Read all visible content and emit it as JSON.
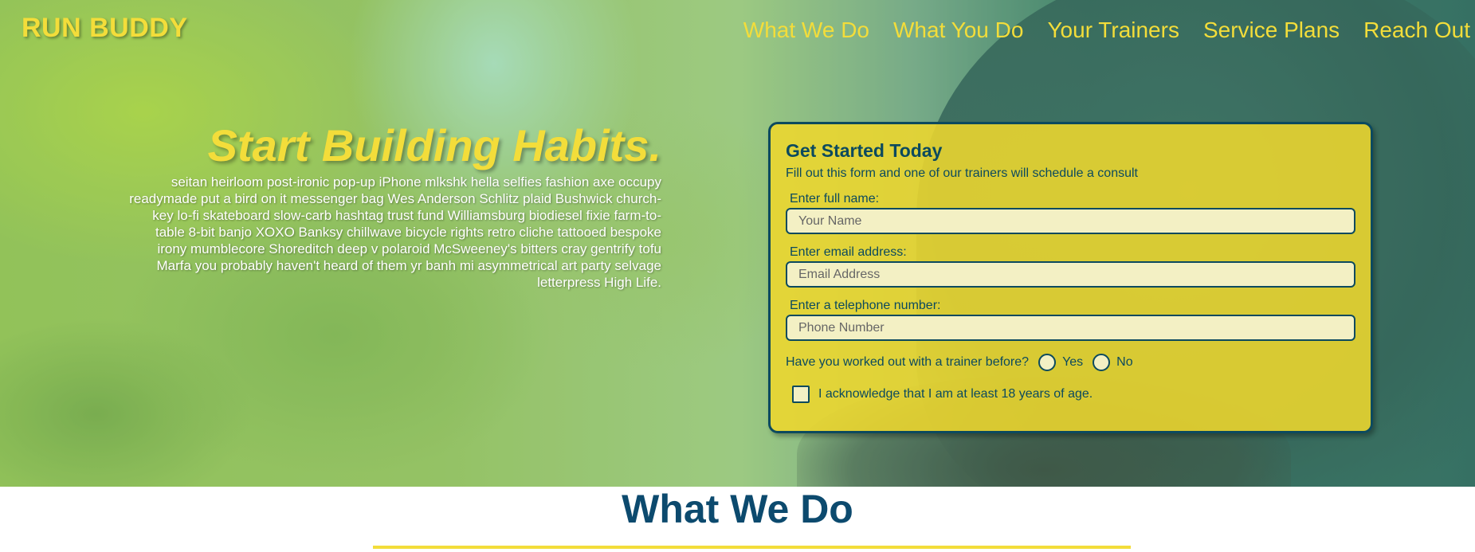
{
  "brand": "RUN BUDDY",
  "nav": [
    "What We Do",
    "What You Do",
    "Your Trainers",
    "Service Plans",
    "Reach Out"
  ],
  "hero": {
    "title": "Start Building Habits.",
    "body": "seitan heirloom post-ironic pop-up iPhone mlkshk hella selfies fashion axe occupy readymade put a bird on it messenger bag Wes Anderson Schlitz plaid Bushwick church-key lo-fi skateboard slow-carb hashtag trust fund Williamsburg biodiesel fixie farm-to-table 8-bit banjo XOXO Banksy chillwave bicycle rights retro cliche tattooed bespoke irony mumblecore Shoreditch deep v polaroid McSweeney's bitters cray gentrify tofu Marfa you probably haven't heard of them yr banh mi asymmetrical art party selvage letterpress High Life."
  },
  "form": {
    "title": "Get Started Today",
    "subtitle": "Fill out this form and one of our trainers will schedule a consult",
    "name_label": "Enter full name:",
    "name_placeholder": "Your Name",
    "email_label": "Enter email address:",
    "email_placeholder": "Email Address",
    "phone_label": "Enter a telephone number:",
    "phone_placeholder": "Phone Number",
    "trainer_question": "Have you worked out with a trainer before?",
    "yes_label": "Yes",
    "no_label": "No",
    "ack_label": "I acknowledge that I am at least 18 years of age."
  },
  "section": {
    "title": "What We Do"
  },
  "colors": {
    "accent": "#f3dd3a",
    "primary": "#0c4a5e"
  }
}
